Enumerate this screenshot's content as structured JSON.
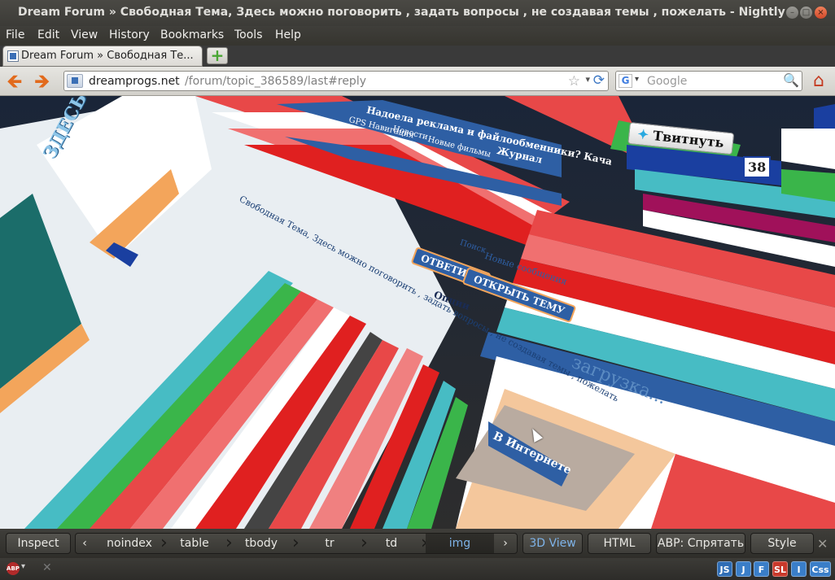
{
  "window": {
    "title": "Dream Forum » Свободная Тема, Здесь можно поговорить , задать вопросы , не создавая темы , пожелать - Nightly"
  },
  "menu": [
    "File",
    "Edit",
    "View",
    "History",
    "Bookmarks",
    "Tools",
    "Help"
  ],
  "tab": {
    "label": "Dream Forum » Свободная Те..."
  },
  "navigation": {
    "url_domain": "dreamprogs.net",
    "url_path": "/forum/topic_386589/last#reply",
    "search_placeholder": "Google",
    "search_engine_letter": "G"
  },
  "page_3d": {
    "heading_left": "ЗДЕСЬ МОЖНО ПОГОВОРИТЬ",
    "blue_banner_1": "Надоела реклама и файлообменники? Кача",
    "blue_banner_2": "Журнал",
    "menu_row": "Новые фильмы",
    "menu_row_2": "Новости",
    "menu_row_3": "GPS Навигация",
    "post_text": "Свободная Тема, Здесь можно поговорить , задать вопросы , не создавая темы , пожелать",
    "reply_button": "ОТВЕТИТЬ",
    "open_topic_button": "ОТКРЫТЬ ТЕМУ",
    "options": "Опции",
    "search_link": "Поиск",
    "new_messages": "Новые сообщения",
    "tweet_button": "Твитнуть",
    "tweet_count": "38",
    "loading": "загрузка...",
    "internet_label": "В Интернете"
  },
  "inspector": {
    "inspect": "Inspect",
    "crumbs": [
      "noindex",
      "table",
      "tbody",
      "tr",
      "td",
      "img"
    ],
    "selected_crumb": "img",
    "view3d": "3D View",
    "html": "HTML",
    "abp_hide": "ABP: Спрятать",
    "style": "Style"
  },
  "statusbar": {
    "abp": "ABP",
    "buttons": [
      {
        "label": "JS",
        "color": "#2f6db5"
      },
      {
        "label": "J",
        "color": "#3a7ec8"
      },
      {
        "label": "F",
        "color": "#3a7ec8"
      },
      {
        "label": "SL",
        "color": "#c9392b"
      },
      {
        "label": "I",
        "color": "#3a7ec8"
      },
      {
        "label": "Css",
        "color": "#3a7ec8"
      }
    ]
  }
}
